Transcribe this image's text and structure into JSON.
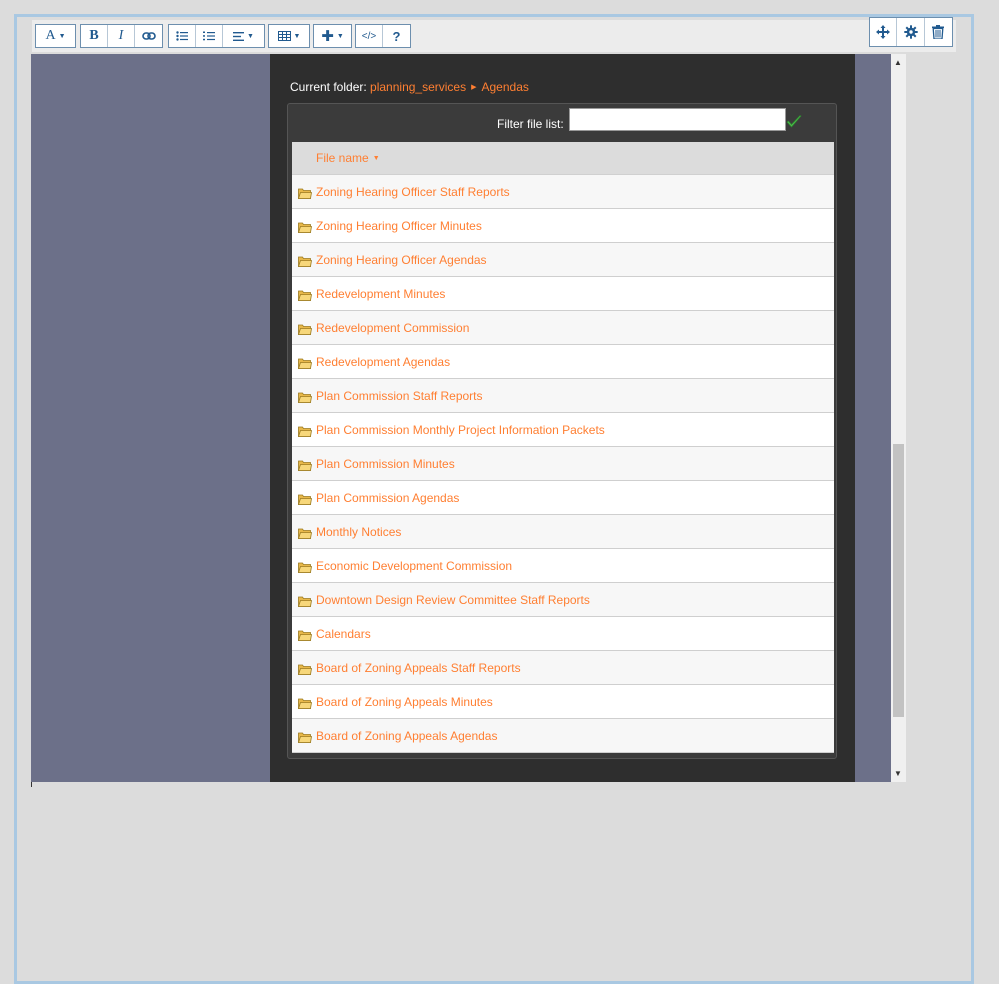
{
  "toolbar": {
    "groups": [
      {
        "items": [
          {
            "icon": "font-style-icon",
            "label": "A",
            "dropdown": true
          }
        ]
      },
      {
        "items": [
          {
            "icon": "bold-icon",
            "label": "B"
          },
          {
            "icon": "italic-icon",
            "label": "I"
          },
          {
            "icon": "link-icon",
            "label": ""
          }
        ]
      },
      {
        "items": [
          {
            "icon": "bullet-list-icon",
            "label": ""
          },
          {
            "icon": "numbered-list-icon",
            "label": ""
          },
          {
            "icon": "align-icon",
            "label": "",
            "dropdown": true
          }
        ]
      },
      {
        "items": [
          {
            "icon": "table-icon",
            "label": "",
            "dropdown": true
          }
        ]
      },
      {
        "items": [
          {
            "icon": "insert-plus-icon",
            "label": "",
            "dropdown": true
          }
        ]
      },
      {
        "items": [
          {
            "icon": "code-icon",
            "label": "</>"
          },
          {
            "icon": "help-icon",
            "label": "?"
          }
        ]
      }
    ],
    "right_actions": [
      {
        "icon": "move-icon"
      },
      {
        "icon": "gear-icon"
      },
      {
        "icon": "trash-icon"
      }
    ]
  },
  "file_browser": {
    "current_folder_label": "Current folder:",
    "breadcrumb": [
      "planning_services",
      "Agendas"
    ],
    "filter_label": "Filter file list:",
    "filter_value": "",
    "column_header": "File name",
    "rows": [
      {
        "name": "Zoning Hearing Officer Staff Reports"
      },
      {
        "name": "Zoning Hearing Officer Minutes"
      },
      {
        "name": "Zoning Hearing Officer Agendas"
      },
      {
        "name": "Redevelopment Minutes"
      },
      {
        "name": "Redevelopment Commission"
      },
      {
        "name": "Redevelopment Agendas"
      },
      {
        "name": "Plan Commission Staff Reports"
      },
      {
        "name": "Plan Commission Monthly Project Information Packets"
      },
      {
        "name": "Plan Commission Minutes"
      },
      {
        "name": "Plan Commission Agendas"
      },
      {
        "name": "Monthly Notices"
      },
      {
        "name": "Economic Development Commission"
      },
      {
        "name": "Downtown Design Review Committee Staff Reports"
      },
      {
        "name": "Calendars"
      },
      {
        "name": "Board of Zoning Appeals Staff Reports"
      },
      {
        "name": "Board of Zoning Appeals Minutes"
      },
      {
        "name": "Board of Zoning Appeals Agendas"
      }
    ]
  },
  "colors": {
    "accent": "#ff7f32",
    "toolbar_icon": "#215a8f",
    "editor_bg": "#6c7089",
    "panel_bg": "#2e2e2e",
    "frame_border": "#a9c8e2"
  }
}
